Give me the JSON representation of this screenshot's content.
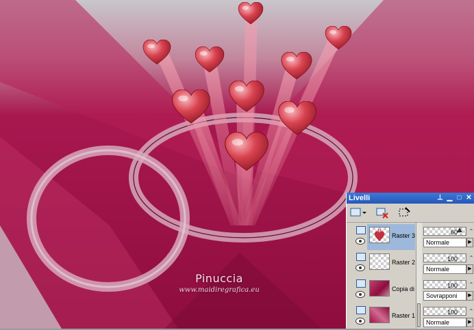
{
  "artwork": {
    "signature": "Pinuccia",
    "website": "www.maidiregrafica.eu"
  },
  "colors": {
    "main_crimson": "#a3124a",
    "light_pink": "#e3a5bd",
    "gray_border": "#9a9aa2",
    "palette_bg": "#d4d0c8",
    "titlebar_blue": "#2d64c8",
    "selection_blue": "#9db8da"
  },
  "palette": {
    "title": "Livelli",
    "title_buttons": [
      "pin-icon",
      "minimize-icon",
      "maximize-icon",
      "close-icon"
    ],
    "toolbar": [
      "new-raster-layer-icon",
      "delete-layer-icon",
      "selection-icon"
    ],
    "layers": [
      {
        "name": "Raster 3",
        "opacity": "60",
        "blend": "Normale",
        "selected": true,
        "thumb": "hearts"
      },
      {
        "name": "Raster 2",
        "opacity": "100",
        "blend": "Normale",
        "selected": false,
        "thumb": "transparent"
      },
      {
        "name": "Copia di",
        "opacity": "100",
        "blend": "Sovrapponi",
        "selected": false,
        "thumb": "crimson"
      },
      {
        "name": "Raster 1",
        "opacity": "100",
        "blend": "Normale",
        "selected": false,
        "thumb": "crimson"
      }
    ]
  }
}
